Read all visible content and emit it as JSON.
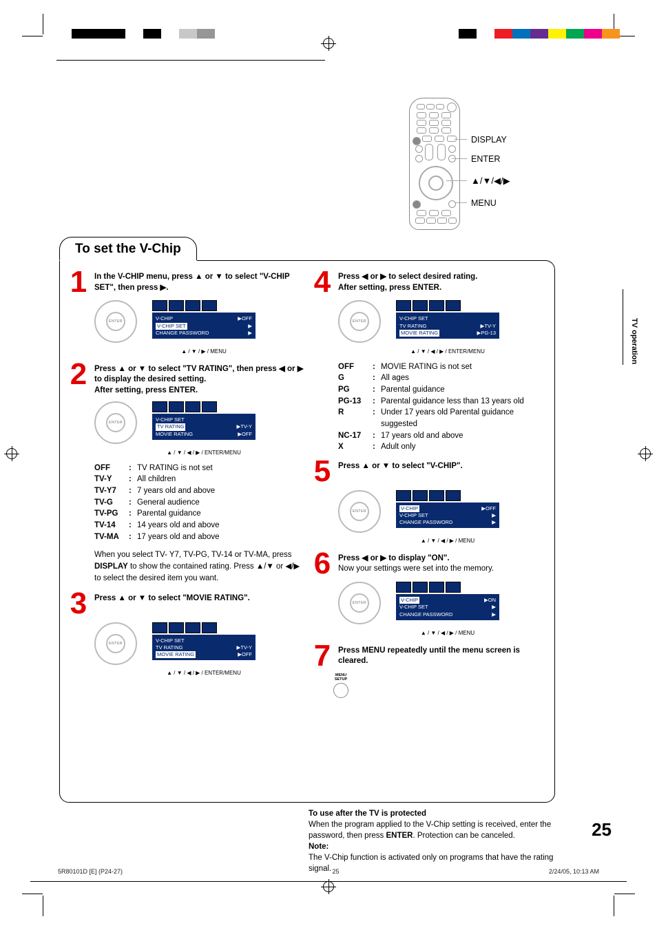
{
  "section_title": "To set the V-Chip",
  "side_tab": "TV operation",
  "page_number": "25",
  "remote_labels": {
    "display": "DISPLAY",
    "enter": "ENTER",
    "arrows": "▲/▼/◀/▶",
    "menu": "MENU"
  },
  "arrows": {
    "u": "▲",
    "d": "▼",
    "l": "◀",
    "r": "▶"
  },
  "steps": {
    "1": {
      "text_a": "In the V-CHIP menu, press ▲ or ▼  to select \"V-CHIP SET\", then press ▶."
    },
    "2": {
      "text_a": "Press ▲ or ▼ to select \"TV RATING\", then press ◀ or ▶ to display the desired setting.",
      "text_b": "After setting, press ENTER."
    },
    "3": {
      "text_a": "Press ▲ or ▼ to select \"MOVIE RATING\"."
    },
    "4": {
      "text_a": "Press ◀ or ▶ to select desired rating.",
      "text_b": "After setting, press ENTER."
    },
    "5": {
      "text_a": "Press ▲ or ▼ to select \"V-CHIP\"."
    },
    "6": {
      "text_a": "Press ◀ or ▶ to display \"ON\".",
      "text_b": "Now your settings were set into the memory."
    },
    "7": {
      "text_a": "Press MENU repeatedly until the menu screen is cleared."
    }
  },
  "menu_btn": {
    "line1": "MENU",
    "line2": "SETUP"
  },
  "osd": {
    "m1": {
      "vchip": "V-CHIP",
      "vchip_val": "▶OFF",
      "set": "V-CHIP SET",
      "set_val": "▶",
      "pass": "CHANGE PASSWORD",
      "pass_val": "▶",
      "foot": "▲ / ▼ / ▶ / MENU"
    },
    "m2": {
      "title": "V-CHIP SET",
      "tv": "TV RATING",
      "tv_val": "▶TV-Y",
      "mov": "MOVIE RATING",
      "mov_val": "▶OFF",
      "foot": "▲ / ▼ / ◀ / ▶ / ENTER/MENU"
    },
    "m3": {
      "title": "V-CHIP SET",
      "tv": "TV RATING",
      "tv_val": "▶TV-Y",
      "mov": "MOVIE RATING",
      "mov_val": "▶OFF",
      "foot": "▲ / ▼ / ◀ / ▶ / ENTER/MENU"
    },
    "m4": {
      "title": "V-CHIP SET",
      "tv": "TV RATING",
      "tv_val": "▶TV-Y",
      "mov": "MOVIE RATING",
      "mov_val": "▶PG-13",
      "foot": "▲ / ▼ / ◀ / ▶ / ENTER/MENU"
    },
    "m5": {
      "vchip": "V-CHIP",
      "vchip_val": "▶OFF",
      "set": "V-CHIP SET",
      "set_val": "▶",
      "pass": "CHANGE PASSWORD",
      "pass_val": "▶",
      "foot": "▲ / ▼ / ◀ / ▶ / MENU"
    },
    "m6": {
      "vchip": "V-CHIP",
      "vchip_val": "▶ON",
      "set": "V-CHIP SET",
      "set_val": "▶",
      "pass": "CHANGE PASSWORD",
      "pass_val": "▶",
      "foot": "▲ / ▼ / ◀ / ▶ / MENU"
    }
  },
  "tv_ratings": [
    {
      "k": "OFF",
      "v": "TV RATING is not set"
    },
    {
      "k": "TV-Y",
      "v": "All children"
    },
    {
      "k": "TV-Y7",
      "v": "7 years old and above"
    },
    {
      "k": "TV-G",
      "v": "General audience"
    },
    {
      "k": "TV-PG",
      "v": "Parental guidance"
    },
    {
      "k": "TV-14",
      "v": "14 years old and above"
    },
    {
      "k": "TV-MA",
      "v": "17 years old and above"
    }
  ],
  "tv_note": {
    "a": "When you select TV- Y7, TV-PG, TV-14 or TV-MA, press ",
    "b": "DISPLAY",
    "c": " to show the contained rating. Press ▲/▼ or ◀/▶ to select the desired item you want."
  },
  "movie_ratings": [
    {
      "k": "OFF",
      "v": "MOVIE RATING is not set"
    },
    {
      "k": "G",
      "v": "All ages"
    },
    {
      "k": "PG",
      "v": "Parental guidance"
    },
    {
      "k": "PG-13",
      "v": "Parental guidance less than 13 years old"
    },
    {
      "k": "R",
      "v": "Under 17 years old Parental guidance suggested"
    },
    {
      "k": "NC-17",
      "v": "17 years old and above"
    },
    {
      "k": "X",
      "v": "Adult only"
    }
  ],
  "after": {
    "title": "To use after the TV is protected",
    "body_a": "When the program applied to the V-Chip setting is received, enter the password, then press ",
    "body_b": "ENTER",
    "body_c": ". Protection can be canceled.",
    "note_label": "Note:",
    "note_body": "The V-Chip function is activated only on programs that have the rating signal."
  },
  "footer": {
    "left": "5R80101D [E] (P24-27)",
    "center": "25",
    "right": "2/24/05, 10:13 AM"
  },
  "colorbars": {
    "left": [
      "#000",
      "#000",
      "#000",
      "#fff",
      "#000",
      "#fff",
      "#c8c8c8",
      "#969696",
      "#fff"
    ],
    "right": [
      "#000",
      "#fff",
      "#eb1c24",
      "#0072bc",
      "#662d91",
      "#fff200",
      "#00a651",
      "#ec008c",
      "#f7941d"
    ]
  }
}
